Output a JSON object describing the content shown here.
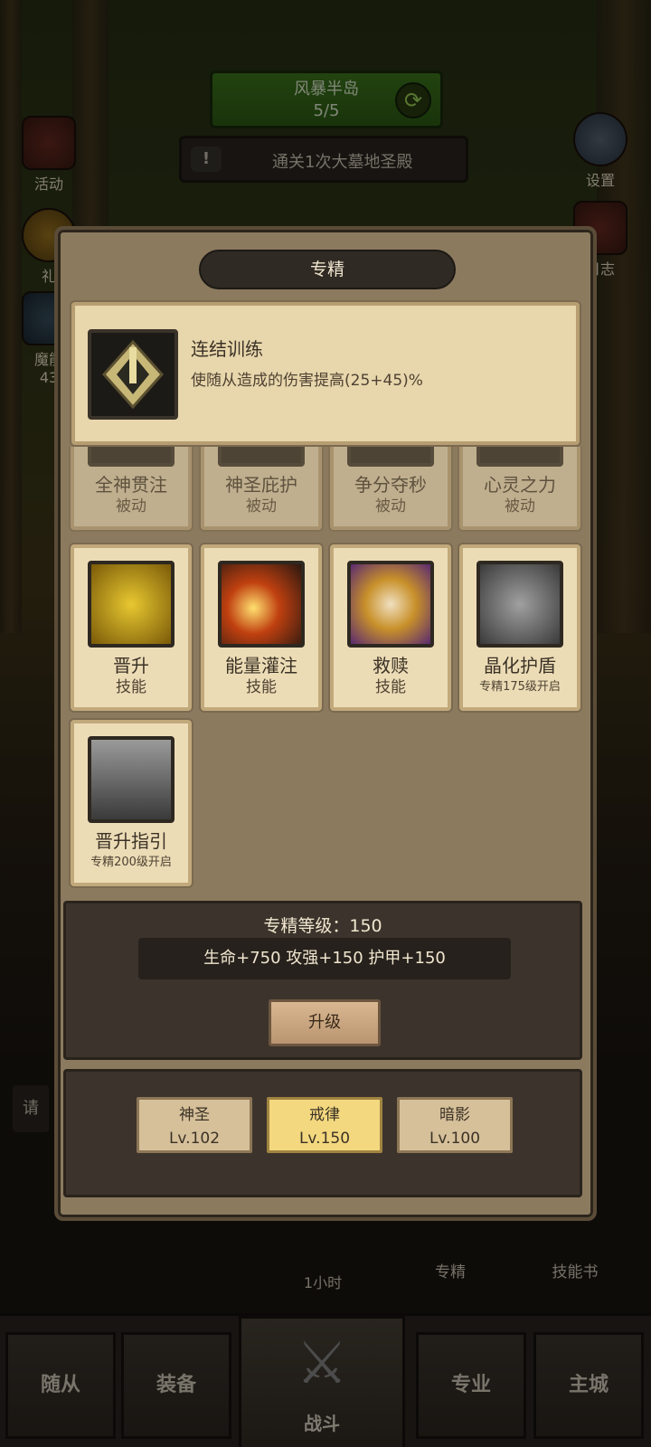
{
  "stage": {
    "name": "风暴半岛",
    "progress": "5/5",
    "refresh_icon": "refresh-icon"
  },
  "quest": {
    "text": "通关1次大墓地圣殿",
    "alert": "!"
  },
  "side_left": [
    {
      "label": "活动",
      "icon": "activity-icon"
    },
    {
      "label": "礼",
      "icon": "gift-icon"
    },
    {
      "label": "魔能",
      "icon": "magic-icon"
    },
    {
      "label": "43",
      "icon": ""
    }
  ],
  "side_right": [
    {
      "label": "设置",
      "icon": "gear-icon"
    },
    {
      "label": "日志",
      "icon": "log-icon"
    }
  ],
  "modal": {
    "title": "专精",
    "detail": {
      "name": "连结训练",
      "desc": "使随从造成的伤害提高(25+45)%"
    },
    "skills_row1": [
      {
        "name": "全神贯注",
        "sub": "被动"
      },
      {
        "name": "神圣庇护",
        "sub": "被动"
      },
      {
        "name": "争分夺秒",
        "sub": "被动"
      },
      {
        "name": "心灵之力",
        "sub": "被动"
      }
    ],
    "skills_row2": [
      {
        "name": "晋升",
        "sub": "技能"
      },
      {
        "name": "能量灌注",
        "sub": "技能"
      },
      {
        "name": "救赎",
        "sub": "技能"
      },
      {
        "name": "晶化护盾",
        "sub": "专精175级开启"
      }
    ],
    "skills_row3": [
      {
        "name": "晋升指引",
        "sub": "专精200级开启"
      }
    ],
    "level": {
      "label": "专精等级：150",
      "stats": "生命+750 攻强+150 护甲+150",
      "upgrade": "升级"
    },
    "trees": [
      {
        "name": "神圣",
        "level": "Lv.102"
      },
      {
        "name": "戒律",
        "level": "Lv.150"
      },
      {
        "name": "暗影",
        "level": "Lv.100"
      }
    ]
  },
  "under_modal": {
    "timer": "1小时",
    "spec": "专精",
    "skillbook": "技能书",
    "hint": "请"
  },
  "nav": {
    "followers": "随从",
    "equipment": "装备",
    "battle": "战斗",
    "profession": "专业",
    "city": "主城"
  }
}
